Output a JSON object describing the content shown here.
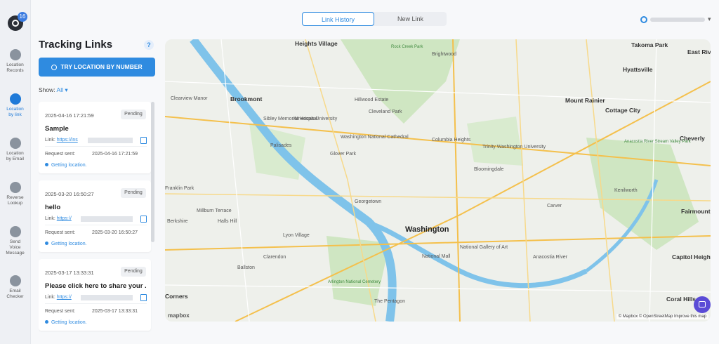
{
  "app": {
    "badge_count": "16",
    "accent": "#2f8be0"
  },
  "nav": [
    {
      "label1": "Location",
      "label2": "Records",
      "icon": "location-pin-icon"
    },
    {
      "label1": "Location",
      "label2": "by link",
      "icon": "link-icon",
      "active": true
    },
    {
      "label1": "Location",
      "label2": "by Email",
      "icon": "email-icon"
    },
    {
      "label1": "Reverse",
      "label2": "Lookup",
      "icon": "reverse-lookup-icon"
    },
    {
      "label1": "Send",
      "label2": "Voice",
      "label3": "Message",
      "icon": "voice-icon"
    },
    {
      "label1": "Email",
      "label2": "Checker",
      "icon": "envelope-icon"
    }
  ],
  "tabs": {
    "history": "Link History",
    "new": "New Link"
  },
  "panel": {
    "title": "Tracking Links",
    "help": "?",
    "try_button": "TRY LOCATION BY NUMBER",
    "show_label": "Show:",
    "show_value": "All",
    "links": [
      {
        "created": "2025-04-16 17:21:59",
        "status": "Pending",
        "name": "Sample",
        "link_label": "Link:",
        "link_text": "https://ins",
        "sent_label": "Request sent:",
        "sent": "2025-04-16 17:21:59",
        "geo": "Getting location."
      },
      {
        "created": "2025-03-20 16:50:27",
        "status": "Pending",
        "name": "hello",
        "link_label": "Link:",
        "link_text": "https://",
        "sent_label": "Request sent:",
        "sent": "2025-03-20 16:50:27",
        "geo": "Getting location."
      },
      {
        "created": "2025-03-17 13:33:31",
        "status": "Pending",
        "name": "Please click here to share your ...",
        "link_label": "Link:",
        "link_text": "https://",
        "sent_label": "Request sent:",
        "sent": "2025-03-17 13:33:31",
        "geo": "Getting location."
      }
    ]
  },
  "map": {
    "city": "Washington",
    "labels": [
      "Heights Village",
      "Rock Creek Park",
      "Brightwood",
      "Takoma Park",
      "East Riv",
      "Hyattsville",
      "Brookmont",
      "Sibley Memorial Hospital",
      "American University",
      "Hillwood Estate",
      "Cleveland Park",
      "Washington National Cathedral",
      "Mount Rainier",
      "Cottage City",
      "Cheverly",
      "Anacostia River Stream Valley Park",
      "Trinity Washington University",
      "Columbia Heights",
      "Bloomingdale",
      "Palisades",
      "Glover Park",
      "Georgetown",
      "Lyon Village",
      "Clarendon",
      "Ballston",
      "Arlington National Cemetery",
      "National Mall",
      "National Gallery of Art",
      "Capitol Heights",
      "Fairmount Heights",
      "Coral Hills",
      "Kenilworth",
      "Carver",
      "Halls Hill",
      "Berkshire",
      "Millburn Terrace",
      "Clearview Manor",
      "Franklin Park",
      "Corners",
      "The Pentagon",
      "Anacostia River"
    ],
    "attribution": "© Mapbox © OpenStreetMap  Improve this map",
    "brand": "mapbox"
  }
}
